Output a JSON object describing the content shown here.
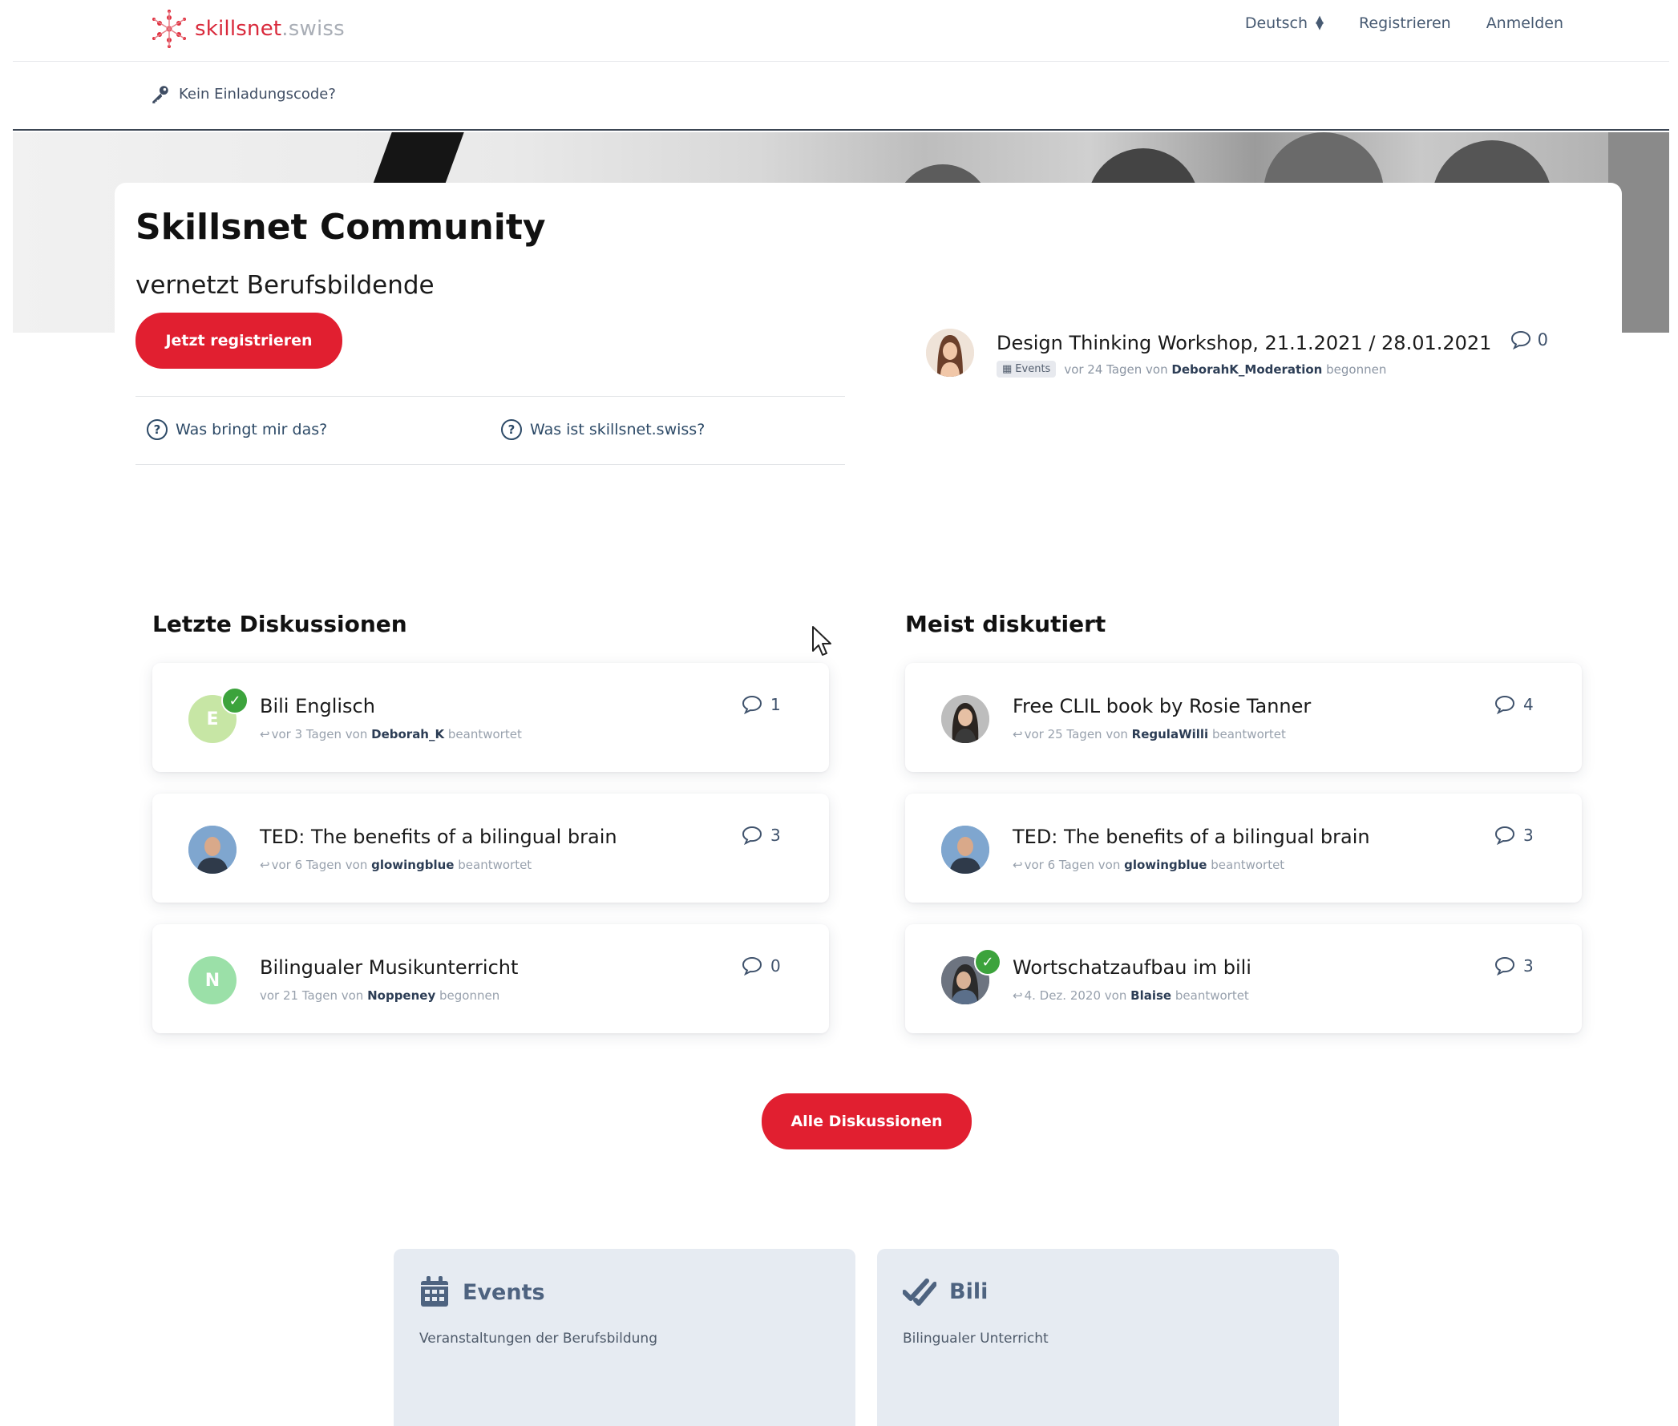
{
  "header": {
    "logo_name": "skillsnet",
    "logo_tld": ".swiss",
    "language": "Deutsch",
    "register": "Registrieren",
    "login": "Anmelden",
    "invite_link": "Kein Einladungscode?"
  },
  "hero": {
    "title": "Skillsnet Community",
    "subtitle": "vernetzt Berufsbildende",
    "register_button": "Jetzt registrieren",
    "link_benefits": "Was bringt mir das?",
    "link_about": "Was ist skillsnet.swiss?"
  },
  "featured": {
    "title": "Design Thinking Workshop, 21.1.2021 / 28.01.2021",
    "tag": "Events",
    "meta_prefix": "vor 24 Tagen von",
    "user": "DeborahK_Moderation",
    "meta_suffix": "begonnen",
    "count": "0"
  },
  "latest": {
    "heading": "Letzte Diskussionen",
    "items": [
      {
        "title": "Bili Englisch",
        "meta_prefix": "vor 3 Tagen von",
        "user": "Deborah_K",
        "meta_suffix": "beantwortet",
        "count": "1",
        "initial": "E"
      },
      {
        "title": "TED: The benefits of a bilingual brain",
        "meta_prefix": "vor 6 Tagen von",
        "user": "glowingblue",
        "meta_suffix": "beantwortet",
        "count": "3"
      },
      {
        "title": "Bilingualer Musikunterricht",
        "meta_prefix": "vor 21 Tagen von",
        "user": "Noppeney",
        "meta_suffix": "begonnen",
        "count": "0",
        "initial": "N"
      }
    ]
  },
  "popular": {
    "heading": "Meist diskutiert",
    "items": [
      {
        "title": "Free CLIL book by Rosie Tanner",
        "meta_prefix": "vor 25 Tagen von",
        "user": "RegulaWilli",
        "meta_suffix": "beantwortet",
        "count": "4"
      },
      {
        "title": "TED: The benefits of a bilingual brain",
        "meta_prefix": "vor 6 Tagen von",
        "user": "glowingblue",
        "meta_suffix": "beantwortet",
        "count": "3"
      },
      {
        "title": "Wortschatzaufbau im bili",
        "meta_prefix": "4. Dez. 2020 von",
        "user": "Blaise",
        "meta_suffix": "beantwortet",
        "count": "3"
      }
    ]
  },
  "all_discussions_button": "Alle Diskussionen",
  "tiles": [
    {
      "title": "Events",
      "description": "Veranstaltungen der Berufsbildung",
      "icon": "calendar-icon"
    },
    {
      "title": "Bili",
      "description": "Bilingualer Unterricht",
      "icon": "double-check-icon"
    }
  ],
  "colors": {
    "brand_red": "#e11f30",
    "tile_bg": "#e6ebf2",
    "text_link": "#475a72"
  }
}
